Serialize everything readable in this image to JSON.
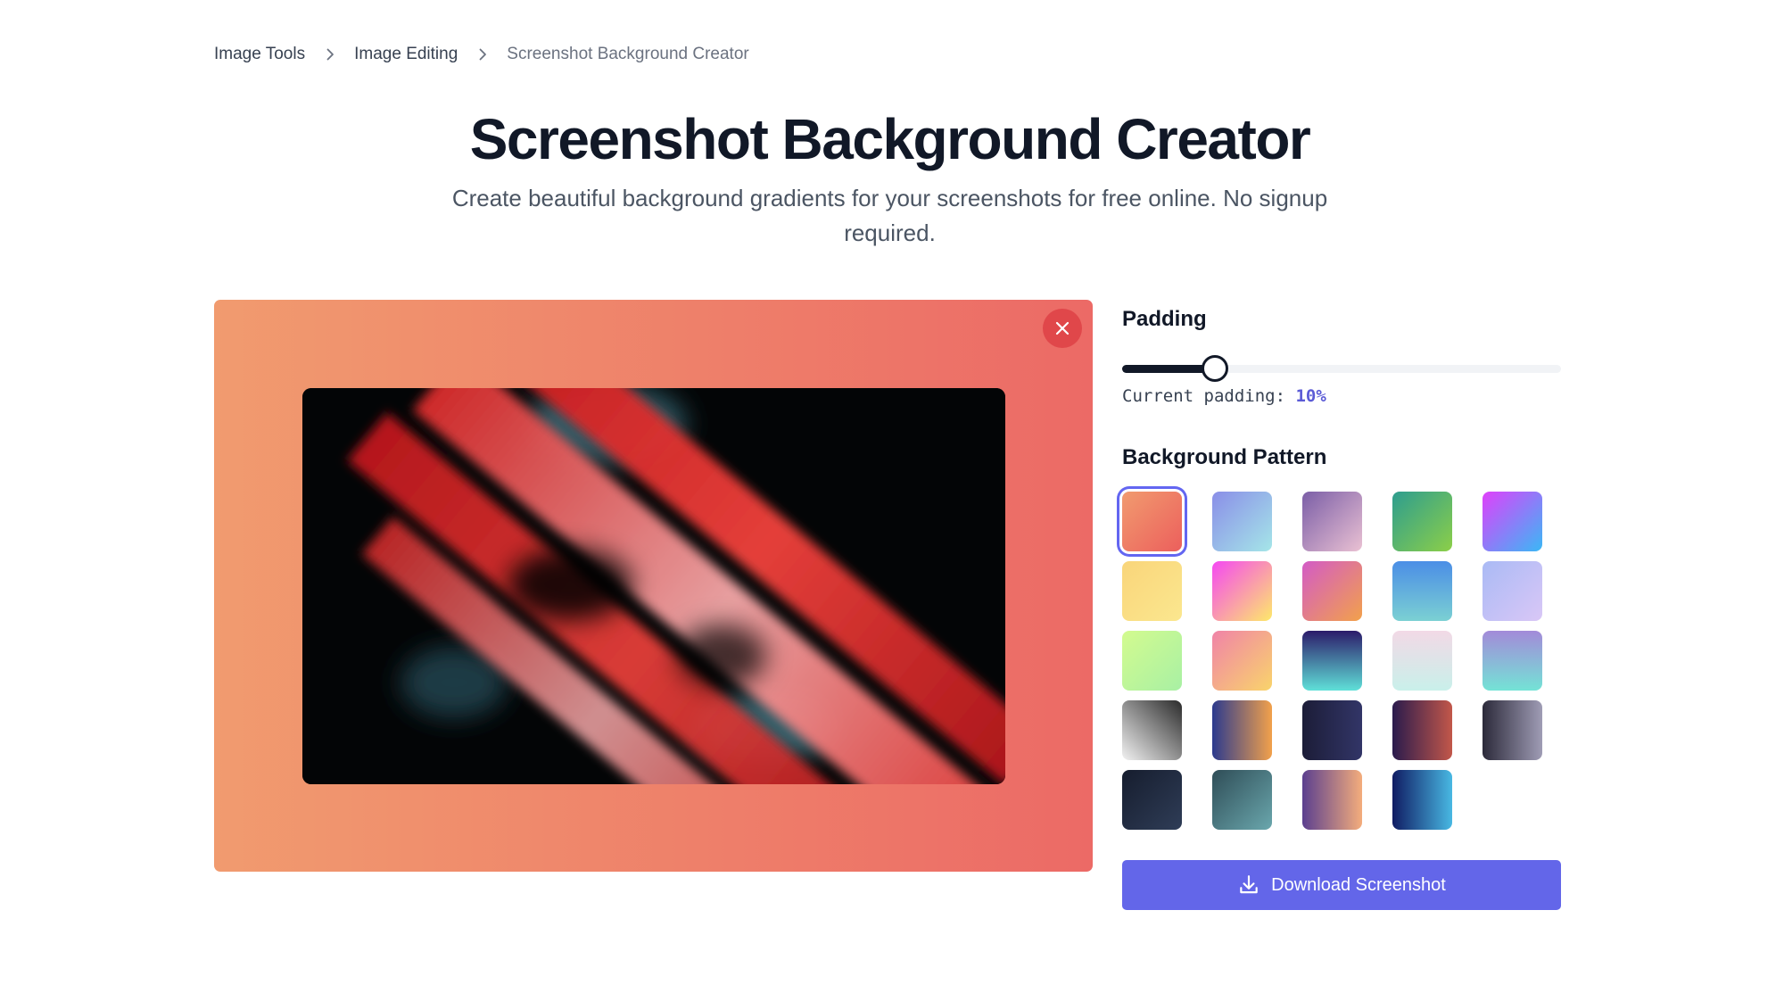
{
  "breadcrumb": {
    "items": [
      {
        "label": "Image Tools"
      },
      {
        "label": "Image Editing"
      },
      {
        "label": "Screenshot Background Creator"
      }
    ]
  },
  "header": {
    "title": "Screenshot Background Creator",
    "subtitle": "Create beautiful background gradients for your screenshots for free online. No signup required."
  },
  "preview": {
    "background": {
      "from": "#f19b6f",
      "to": "#ec6a66"
    },
    "close_icon": "close-icon"
  },
  "padding": {
    "label": "Padding",
    "readout_label": "Current padding:",
    "value_text": "10%",
    "value_fraction": 0.21
  },
  "patterns": {
    "label": "Background Pattern",
    "selected_index": 0,
    "swatches": [
      {
        "from": "#f19b6f",
        "to": "#ec5f5c",
        "angle": 135
      },
      {
        "from": "#8a8ee8",
        "to": "#a5e6e8",
        "angle": 135
      },
      {
        "from": "#7b5ea7",
        "to": "#eac1d3",
        "angle": 135
      },
      {
        "from": "#2d9d8f",
        "to": "#8ccf48",
        "angle": 135
      },
      {
        "from": "#e040fb",
        "to": "#3ab8f5",
        "angle": 135
      },
      {
        "from": "#f9d57a",
        "to": "#fbe78f",
        "angle": 135
      },
      {
        "from": "#f548f2",
        "to": "#fde96a",
        "angle": 135
      },
      {
        "from": "#d35bc6",
        "to": "#f2a14b",
        "angle": 135
      },
      {
        "from": "#4b8ee6",
        "to": "#7bd0d3",
        "angle": 180
      },
      {
        "from": "#aabaf5",
        "to": "#d9c7f6",
        "angle": 135
      },
      {
        "from": "#d3fb8f",
        "to": "#a8f0a4",
        "angle": 135
      },
      {
        "from": "#f083a8",
        "to": "#f9d46b",
        "angle": 135
      },
      {
        "from": "#2c1b6a",
        "to": "#5fe0d8",
        "angle": 180
      },
      {
        "from": "#f2d9e6",
        "to": "#c9f0ea",
        "angle": 180
      },
      {
        "from": "#a38ad9",
        "to": "#74e3d6",
        "angle": 180
      },
      {
        "from": "#2b2b2b",
        "to": "#f2f2f2",
        "angle": 225
      },
      {
        "from": "#2c3a8e",
        "to": "#f2a14b",
        "angle": 90
      },
      {
        "from": "#1c1d38",
        "to": "#323567",
        "angle": 90
      },
      {
        "from": "#2a1b4d",
        "to": "#c2574a",
        "angle": 90
      },
      {
        "from": "#2c2a3a",
        "to": "#9f9cb5",
        "angle": 90
      },
      {
        "from": "#161d2e",
        "to": "#2f3d57",
        "angle": 135
      },
      {
        "from": "#2f4d57",
        "to": "#6aa7ad",
        "angle": 135
      },
      {
        "from": "#5b3f8f",
        "to": "#f4ad7c",
        "angle": 90
      },
      {
        "from": "#101c63",
        "to": "#48b8e3",
        "angle": 90
      }
    ]
  },
  "download": {
    "label": "Download Screenshot",
    "icon": "download-icon"
  }
}
